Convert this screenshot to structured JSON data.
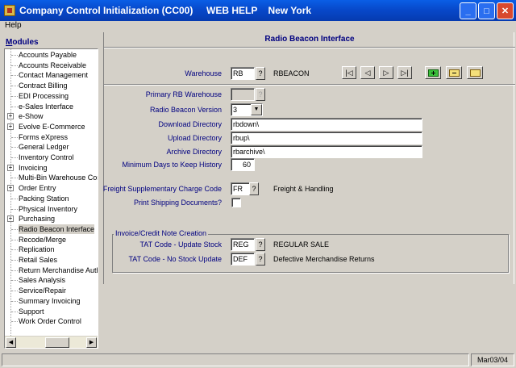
{
  "window": {
    "title": "Company Control Initialization (CC00)     WEB HELP    New York"
  },
  "menu": {
    "help": "Help"
  },
  "sidebar": {
    "title": "Modules",
    "items": [
      {
        "label": "Accounts Payable",
        "expandable": false
      },
      {
        "label": "Accounts Receivable",
        "expandable": false
      },
      {
        "label": "Contact Management",
        "expandable": false
      },
      {
        "label": "Contract Billing",
        "expandable": false
      },
      {
        "label": "EDI Processing",
        "expandable": false
      },
      {
        "label": "e-Sales Interface",
        "expandable": false
      },
      {
        "label": "e-Show",
        "expandable": true
      },
      {
        "label": "Evolve E-Commerce",
        "expandable": true
      },
      {
        "label": "Forms eXpress",
        "expandable": false
      },
      {
        "label": "General Ledger",
        "expandable": false
      },
      {
        "label": "Inventory Control",
        "expandable": false
      },
      {
        "label": "Invoicing",
        "expandable": true
      },
      {
        "label": "Multi-Bin Warehouse Con",
        "expandable": false
      },
      {
        "label": "Order Entry",
        "expandable": true
      },
      {
        "label": "Packing Station",
        "expandable": false
      },
      {
        "label": "Physical Inventory",
        "expandable": false
      },
      {
        "label": "Purchasing",
        "expandable": true
      },
      {
        "label": "Radio Beacon Interface",
        "expandable": false,
        "selected": true
      },
      {
        "label": "Recode/Merge",
        "expandable": false
      },
      {
        "label": "Replication",
        "expandable": false
      },
      {
        "label": "Retail Sales",
        "expandable": false
      },
      {
        "label": "Return Merchandise Auth",
        "expandable": false
      },
      {
        "label": "Sales Analysis",
        "expandable": false
      },
      {
        "label": "Service/Repair",
        "expandable": false
      },
      {
        "label": "Summary Invoicing",
        "expandable": false
      },
      {
        "label": "Support",
        "expandable": false
      },
      {
        "label": "Work Order Control",
        "expandable": false
      }
    ]
  },
  "main": {
    "title": "Radio Beacon Interface",
    "warehouse": {
      "label": "Warehouse",
      "value": "RB",
      "description": "RBEACON"
    },
    "primary_rb_warehouse": {
      "label": "Primary RB Warehouse",
      "value": ""
    },
    "radio_beacon_version": {
      "label": "Radio Beacon Version",
      "value": "3"
    },
    "download_directory": {
      "label": "Download Directory",
      "value": "rbdown\\"
    },
    "upload_directory": {
      "label": "Upload Directory",
      "value": "rbup\\"
    },
    "archive_directory": {
      "label": "Archive Directory",
      "value": "rbarchive\\"
    },
    "min_days_history": {
      "label": "Minimum Days to Keep History",
      "value": "60"
    },
    "freight_code": {
      "label": "Freight Supplementary Charge Code",
      "value": "FR",
      "description": "Freight & Handling"
    },
    "print_shipping": {
      "label": "Print Shipping Documents?",
      "checked": false
    },
    "invoice_group": {
      "title": "Invoice/Credit Note Creation",
      "update_stock": {
        "label": "TAT Code - Update Stock",
        "value": "REG",
        "description": "REGULAR SALE"
      },
      "no_stock_update": {
        "label": "TAT Code - No Stock Update",
        "value": "DEF",
        "description": "Defective Merchandise Returns"
      }
    },
    "lookup_glyph": "?"
  },
  "statusbar": {
    "date": "Mar03/04"
  }
}
